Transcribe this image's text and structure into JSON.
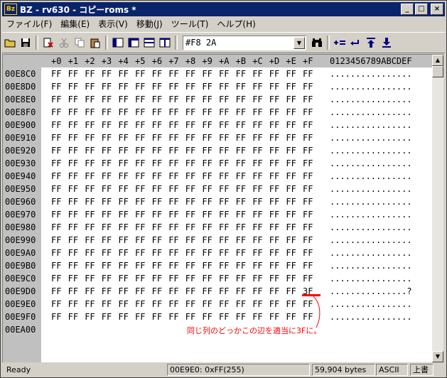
{
  "window": {
    "app_icon_text": "Bz",
    "title": "BZ - rv630 - コピーroms *",
    "controls": {
      "minimize": "_",
      "maximize": "□",
      "close": "×"
    }
  },
  "menu": [
    {
      "label": "ファイル(F)"
    },
    {
      "label": "編集(E)"
    },
    {
      "label": "表示(V)"
    },
    {
      "label": "移動(J)"
    },
    {
      "label": "ツール(T)"
    },
    {
      "label": "ヘルプ(H)"
    }
  ],
  "toolbar": {
    "icons": [
      "open-icon",
      "save-icon",
      "cut-red-icon",
      "cut-icon",
      "copy-icon",
      "paste-icon",
      "view1-icon",
      "view2-icon",
      "view3-icon",
      "view4-icon"
    ],
    "address_value": "#F8 2A",
    "combo_arrow": "▼",
    "right_icons": [
      "binoculars-icon",
      "plus-equals-icon",
      "return-icon",
      "jump-top-icon",
      "jump-bottom-icon"
    ]
  },
  "hex_view": {
    "header_columns": [
      "+0",
      "+1",
      "+2",
      "+3",
      "+4",
      "+5",
      "+6",
      "+7",
      "+8",
      "+9",
      "+A",
      "+B",
      "+C",
      "+D",
      "+E",
      "+F"
    ],
    "ascii_header": "0123456789ABCDEF",
    "rows": [
      {
        "addr": "00E8C0",
        "bytes": [
          "FF",
          "FF",
          "FF",
          "FF",
          "FF",
          "FF",
          "FF",
          "FF",
          "FF",
          "FF",
          "FF",
          "FF",
          "FF",
          "FF",
          "FF",
          "FF"
        ],
        "ascii": "................"
      },
      {
        "addr": "00E8D0",
        "bytes": [
          "FF",
          "FF",
          "FF",
          "FF",
          "FF",
          "FF",
          "FF",
          "FF",
          "FF",
          "FF",
          "FF",
          "FF",
          "FF",
          "FF",
          "FF",
          "FF"
        ],
        "ascii": "................"
      },
      {
        "addr": "00E8E0",
        "bytes": [
          "FF",
          "FF",
          "FF",
          "FF",
          "FF",
          "FF",
          "FF",
          "FF",
          "FF",
          "FF",
          "FF",
          "FF",
          "FF",
          "FF",
          "FF",
          "FF"
        ],
        "ascii": "................"
      },
      {
        "addr": "00E8F0",
        "bytes": [
          "FF",
          "FF",
          "FF",
          "FF",
          "FF",
          "FF",
          "FF",
          "FF",
          "FF",
          "FF",
          "FF",
          "FF",
          "FF",
          "FF",
          "FF",
          "FF"
        ],
        "ascii": "................"
      },
      {
        "addr": "00E900",
        "bytes": [
          "FF",
          "FF",
          "FF",
          "FF",
          "FF",
          "FF",
          "FF",
          "FF",
          "FF",
          "FF",
          "FF",
          "FF",
          "FF",
          "FF",
          "FF",
          "FF"
        ],
        "ascii": "................"
      },
      {
        "addr": "00E910",
        "bytes": [
          "FF",
          "FF",
          "FF",
          "FF",
          "FF",
          "FF",
          "FF",
          "FF",
          "FF",
          "FF",
          "FF",
          "FF",
          "FF",
          "FF",
          "FF",
          "FF"
        ],
        "ascii": "................"
      },
      {
        "addr": "00E920",
        "bytes": [
          "FF",
          "FF",
          "FF",
          "FF",
          "FF",
          "FF",
          "FF",
          "FF",
          "FF",
          "FF",
          "FF",
          "FF",
          "FF",
          "FF",
          "FF",
          "FF"
        ],
        "ascii": "................"
      },
      {
        "addr": "00E930",
        "bytes": [
          "FF",
          "FF",
          "FF",
          "FF",
          "FF",
          "FF",
          "FF",
          "FF",
          "FF",
          "FF",
          "FF",
          "FF",
          "FF",
          "FF",
          "FF",
          "FF"
        ],
        "ascii": "................"
      },
      {
        "addr": "00E940",
        "bytes": [
          "FF",
          "FF",
          "FF",
          "FF",
          "FF",
          "FF",
          "FF",
          "FF",
          "FF",
          "FF",
          "FF",
          "FF",
          "FF",
          "FF",
          "FF",
          "FF"
        ],
        "ascii": "................"
      },
      {
        "addr": "00E950",
        "bytes": [
          "FF",
          "FF",
          "FF",
          "FF",
          "FF",
          "FF",
          "FF",
          "FF",
          "FF",
          "FF",
          "FF",
          "FF",
          "FF",
          "FF",
          "FF",
          "FF"
        ],
        "ascii": "................"
      },
      {
        "addr": "00E960",
        "bytes": [
          "FF",
          "FF",
          "FF",
          "FF",
          "FF",
          "FF",
          "FF",
          "FF",
          "FF",
          "FF",
          "FF",
          "FF",
          "FF",
          "FF",
          "FF",
          "FF"
        ],
        "ascii": "................"
      },
      {
        "addr": "00E970",
        "bytes": [
          "FF",
          "FF",
          "FF",
          "FF",
          "FF",
          "FF",
          "FF",
          "FF",
          "FF",
          "FF",
          "FF",
          "FF",
          "FF",
          "FF",
          "FF",
          "FF"
        ],
        "ascii": "................"
      },
      {
        "addr": "00E980",
        "bytes": [
          "FF",
          "FF",
          "FF",
          "FF",
          "FF",
          "FF",
          "FF",
          "FF",
          "FF",
          "FF",
          "FF",
          "FF",
          "FF",
          "FF",
          "FF",
          "FF"
        ],
        "ascii": "................"
      },
      {
        "addr": "00E990",
        "bytes": [
          "FF",
          "FF",
          "FF",
          "FF",
          "FF",
          "FF",
          "FF",
          "FF",
          "FF",
          "FF",
          "FF",
          "FF",
          "FF",
          "FF",
          "FF",
          "FF"
        ],
        "ascii": "................"
      },
      {
        "addr": "00E9A0",
        "bytes": [
          "FF",
          "FF",
          "FF",
          "FF",
          "FF",
          "FF",
          "FF",
          "FF",
          "FF",
          "FF",
          "FF",
          "FF",
          "FF",
          "FF",
          "FF",
          "FF"
        ],
        "ascii": "................"
      },
      {
        "addr": "00E9B0",
        "bytes": [
          "FF",
          "FF",
          "FF",
          "FF",
          "FF",
          "FF",
          "FF",
          "FF",
          "FF",
          "FF",
          "FF",
          "FF",
          "FF",
          "FF",
          "FF",
          "FF"
        ],
        "ascii": "................"
      },
      {
        "addr": "00E9C0",
        "bytes": [
          "FF",
          "FF",
          "FF",
          "FF",
          "FF",
          "FF",
          "FF",
          "FF",
          "FF",
          "FF",
          "FF",
          "FF",
          "FF",
          "FF",
          "FF",
          "FF"
        ],
        "ascii": "................"
      },
      {
        "addr": "00E9D0",
        "bytes": [
          "FF",
          "FF",
          "FF",
          "FF",
          "FF",
          "FF",
          "FF",
          "FF",
          "FF",
          "FF",
          "FF",
          "FF",
          "FF",
          "FF",
          "FF",
          "3F"
        ],
        "ascii": "...............?"
      },
      {
        "addr": "00E9E0",
        "bytes": [
          "FF",
          "FF",
          "FF",
          "FF",
          "FF",
          "FF",
          "FF",
          "FF",
          "FF",
          "FF",
          "FF",
          "FF",
          "FF",
          "FF",
          "FF",
          "FF"
        ],
        "ascii": "................"
      },
      {
        "addr": "00E9F0",
        "bytes": [
          "FF",
          "FF",
          "FF",
          "FF",
          "FF",
          "FF",
          "FF",
          "FF",
          "FF",
          "FF",
          "FF",
          "FF",
          "FF",
          "FF",
          "FF",
          "FF"
        ],
        "ascii": "................"
      },
      {
        "addr": "00EA00",
        "bytes": [],
        "ascii": ""
      }
    ]
  },
  "scrollbar": {
    "up": "▲",
    "down": "▼"
  },
  "annotation": {
    "text": "同じ列のどっかこの辺を適当に3Fに。",
    "color": "#ff0000"
  },
  "status": {
    "ready": "Ready",
    "position": "00E9E0: 0xFF(255)",
    "size": "59,904 bytes",
    "encoding": "ASCII",
    "mode": "上書"
  },
  "colors": {
    "titlebar": "#0a246a",
    "gutter": "#c0c0c0",
    "face": "#d4d0c8",
    "annotation": "#ff0000"
  }
}
